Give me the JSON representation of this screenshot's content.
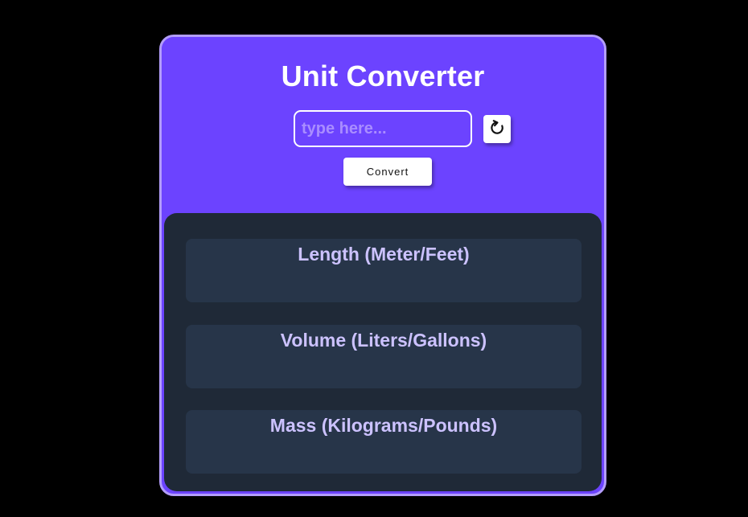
{
  "app": {
    "title": "Unit Converter"
  },
  "converter": {
    "input_value": "",
    "input_placeholder": "type here...",
    "reset_icon": "refresh-icon",
    "convert_label": "Convert"
  },
  "results": [
    {
      "title": "Length (Meter/Feet)",
      "value": ""
    },
    {
      "title": "Volume (Liters/Gallons)",
      "value": ""
    },
    {
      "title": "Mass (Kilograms/Pounds)",
      "value": ""
    }
  ],
  "colors": {
    "background": "#000000",
    "header": "#6c43ff",
    "border": "#b39dfa",
    "panel": "#1f2937",
    "card": "#273549",
    "card_text": "#ccc2ff",
    "button": "#ffffff"
  }
}
